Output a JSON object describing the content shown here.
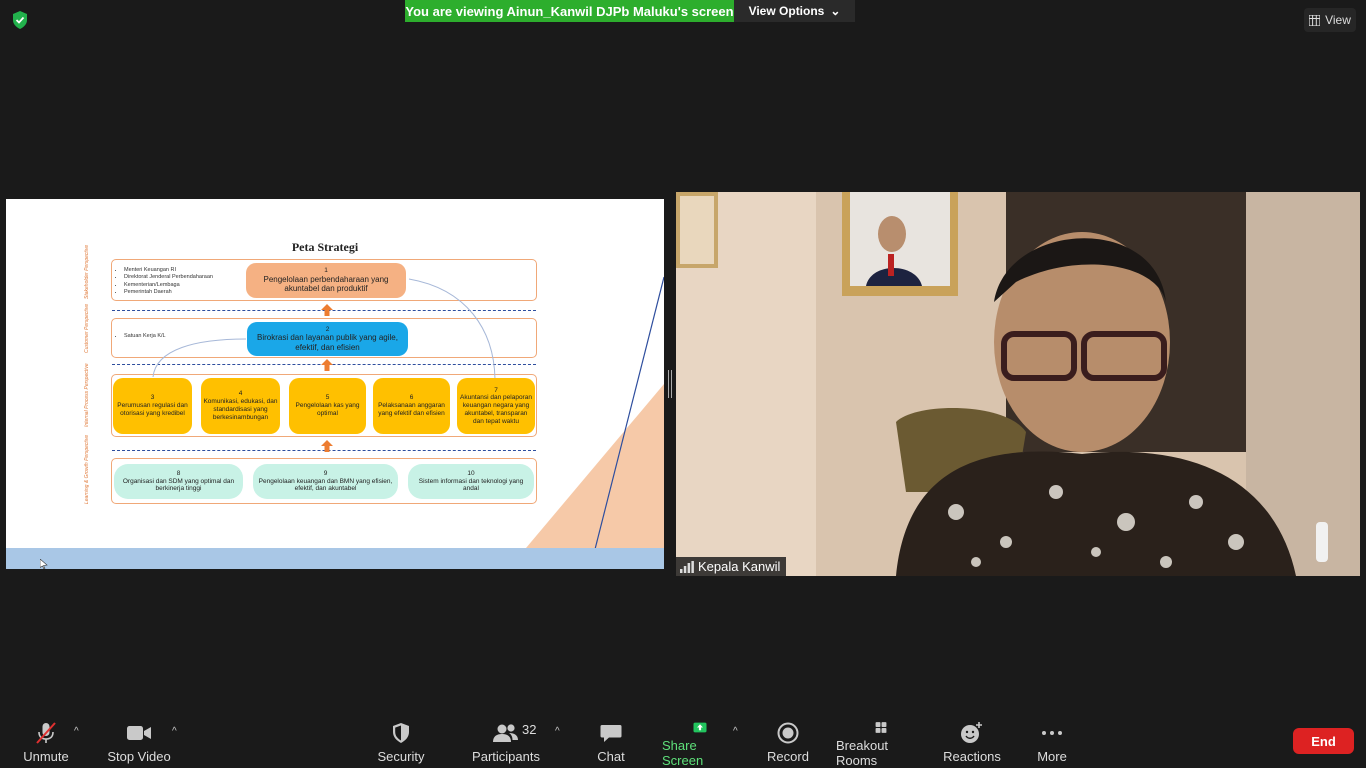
{
  "banner": {
    "viewing_text": "You are viewing Ainun_Kanwil DJPb Maluku's screen",
    "view_options_label": "View Options"
  },
  "view_button_label": "View",
  "slide": {
    "title": "Peta Strategi",
    "perspectives": [
      "Stakeholder Perspective",
      "Customer Perspective",
      "Internal Process Perspective",
      "Learning & Growth Perspective"
    ],
    "stakeholders": [
      "Menteri Keuangan RI",
      "Direktorat Jenderal Perbendaharaan",
      "Kementerian/Lembaga",
      "Pemerintah Daerah"
    ],
    "customers": [
      "Satuan Kerja K/L"
    ],
    "nodes": [
      {
        "num": "1",
        "text": "Pengelolaan perbendaharaan yang akuntabel dan produktif"
      },
      {
        "num": "2",
        "text": "Birokrasi dan layanan publik yang agile, efektif, dan efisien"
      },
      {
        "num": "3",
        "text": "Perumusan regulasi dan otorisasi yang kredibel"
      },
      {
        "num": "4",
        "text": "Komunikasi, edukasi, dan standardisasi yang berkesinambungan"
      },
      {
        "num": "5",
        "text": "Pengelolaan kas yang optimal"
      },
      {
        "num": "6",
        "text": "Pelaksanaan anggaran yang efektif dan efisien"
      },
      {
        "num": "7",
        "text": "Akuntansi dan pelaporan keuangan negara yang akuntabel, transparan dan tepat waktu"
      },
      {
        "num": "8",
        "text": "Organisasi dan SDM yang optimal dan berkinerja tinggi"
      },
      {
        "num": "9",
        "text": "Pengelolaan keuangan dan BMN yang efisien, efektif, dan akuntabel"
      },
      {
        "num": "10",
        "text": "Sistem informasi dan teknologi yang andal"
      }
    ]
  },
  "participant_name": "Kepala Kanwil",
  "toolbar": {
    "unmute": "Unmute",
    "stop_video": "Stop Video",
    "security": "Security",
    "participants": "Participants",
    "participants_count": "32",
    "chat": "Chat",
    "share_screen": "Share Screen",
    "record": "Record",
    "breakout_rooms": "Breakout Rooms",
    "reactions": "Reactions",
    "more": "More",
    "end": "End"
  },
  "colors": {
    "banner_green": "#2dae2d",
    "end_red": "#dd2222",
    "share_green": "#22c55e",
    "node_orange": "#f5b183",
    "node_blue": "#1aa7e8",
    "node_yellow": "#ffc000",
    "node_mint": "#c8f2e6"
  }
}
